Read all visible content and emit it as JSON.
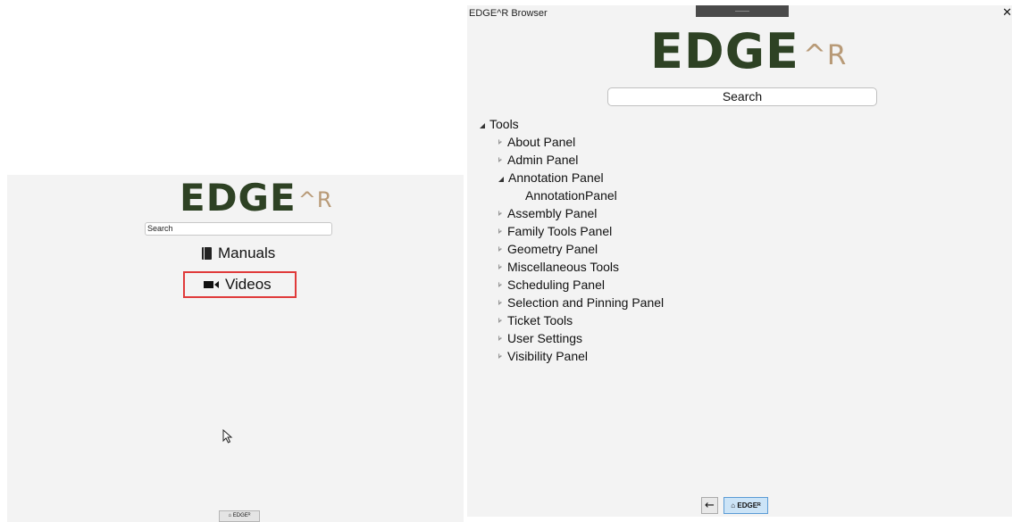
{
  "left": {
    "logo_main": "EDGE",
    "logo_sup": "^R",
    "search_text": "Search",
    "links": {
      "manuals": "Manuals",
      "videos": "Videos"
    },
    "home_button": "⌂ EDGEᴿ"
  },
  "browser": {
    "title": "EDGE^R Browser",
    "close": "✕",
    "logo_main": "EDGE",
    "logo_sup": "^R",
    "search_text": "Search",
    "tree": {
      "root": "Tools",
      "items": [
        "About Panel",
        "Admin Panel",
        "Annotation Panel",
        "Assembly Panel",
        "Family Tools Panel",
        "Geometry Panel",
        "Miscellaneous Tools",
        "Scheduling Panel",
        "Selection and Pinning Panel",
        "Ticket Tools",
        "User Settings",
        "Visibility Panel"
      ],
      "annotation_child": "AnnotationPanel"
    },
    "back_button": "←",
    "home_button": "⌂ EDGEᴿ"
  },
  "colors": {
    "logo_green": "#2e4224",
    "logo_tan": "#b89a77",
    "highlight_red": "#e03a3a",
    "home_blue": "#cce4f7"
  },
  "icons": [
    "book-icon",
    "video-camera-icon",
    "mouse-cursor-icon",
    "home-icon",
    "back-arrow-icon",
    "close-icon",
    "expand-arrow-icon",
    "collapsed-arrow-icon"
  ]
}
